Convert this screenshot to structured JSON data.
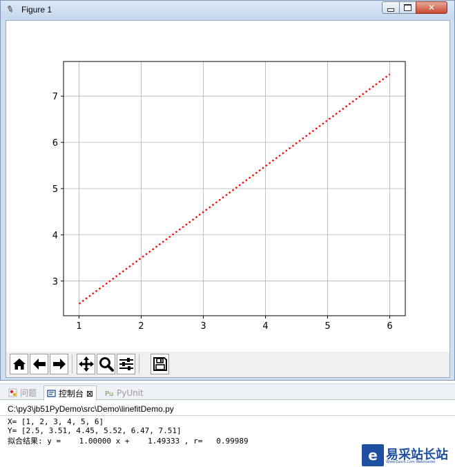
{
  "window": {
    "title": "Figure 1",
    "icon": "feather-icon",
    "controls": [
      "minimize-icon",
      "maximize-icon",
      "close-icon"
    ]
  },
  "chart_data": {
    "type": "line",
    "x": [
      1,
      2,
      3,
      4,
      5,
      6
    ],
    "series": [
      {
        "values": [
          2.50665,
          3.49998,
          4.49331,
          5.48664,
          6.47997,
          7.4733
        ],
        "color": "#ff0000",
        "linestyle": "dotted"
      }
    ],
    "xticks": [
      "1",
      "2",
      "3",
      "4",
      "5",
      "6"
    ],
    "yticks": [
      "3",
      "4",
      "5",
      "6",
      "7"
    ],
    "xlim": [
      0.75,
      6.25
    ],
    "ylim": [
      2.25,
      7.75
    ],
    "grid": true,
    "title": "",
    "xlabel": "",
    "ylabel": ""
  },
  "toolbar": {
    "buttons": [
      "home-icon",
      "back-icon",
      "forward-icon",
      "pan-icon",
      "zoom-icon",
      "configure-subplots-icon",
      "save-icon"
    ]
  },
  "console": {
    "tabs": [
      {
        "label": "问题",
        "icon": "problems-icon"
      },
      {
        "label": "控制台 ⊠",
        "icon": "console-icon",
        "active": true
      },
      {
        "label": "PyUnit",
        "icon": "pyunit-icon"
      }
    ],
    "path": "C:\\py3\\jb51PyDemo\\src\\Demo\\linefitDemo.py",
    "lines": [
      "X= [1, 2, 3, 4, 5, 6]",
      "Y= [2.5, 3.51, 4.45, 5.52, 6.47, 7.51]",
      "拟合结果: y =    1.00000 x +    1.49333 , r=   0.99989"
    ]
  },
  "watermark": {
    "logo": "e",
    "text": "易采站长站",
    "subtext": "Www.Easck.Com  Webmaster"
  }
}
